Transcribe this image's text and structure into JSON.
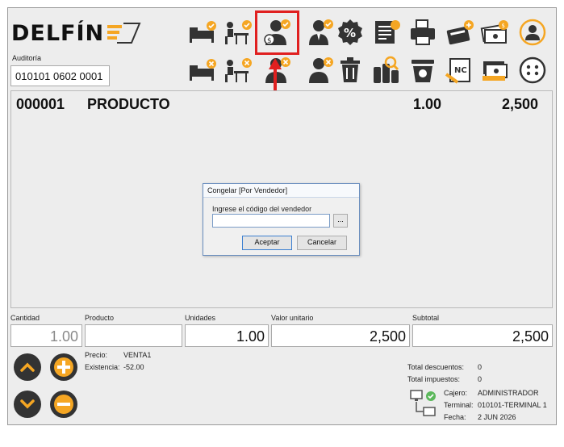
{
  "logo": {
    "text": "DELFÍN"
  },
  "audit": {
    "label": "Auditoría",
    "value": "010101 0602 0001"
  },
  "toolbar": {
    "top_icons": [
      "bed-check-icon",
      "desk-check-icon",
      "seller-money-check-icon",
      "person-check-icon",
      "percent-icon",
      "receipt-icon",
      "printer-icon",
      "cash-register-icon",
      "money-bills-icon",
      "user-refresh-icon"
    ],
    "bottom_icons": [
      "bed-x-icon",
      "desk-x-icon",
      "seller-x-icon",
      "person-x-icon",
      "trash-icon",
      "products-search-icon",
      "scale-icon",
      "credit-note-icon",
      "cash-icon",
      "more-options-icon"
    ]
  },
  "item": {
    "code": "000001",
    "name": "PRODUCTO",
    "qty": "1.00",
    "amount": "2,500"
  },
  "dialog": {
    "title": "Congelar [Por Vendedor]",
    "label": "Ingrese el código del vendedor",
    "input_value": "",
    "dots": "...",
    "accept": "Aceptar",
    "cancel": "Cancelar"
  },
  "fields": {
    "cantidad_label": "Cantidad",
    "cantidad_value": "1.00",
    "producto_label": "Producto",
    "producto_value": "",
    "unidades_label": "Unidades",
    "unidades_value": "1.00",
    "valor_label": "Valor unitario",
    "valor_value": "2,500",
    "subtotal_label": "Subtotal",
    "subtotal_value": "2,500"
  },
  "info": {
    "precio_label": "Precio:",
    "precio_value": "VENTA1",
    "existencia_label": "Existencia:",
    "existencia_value": "-52.00"
  },
  "totals": {
    "descuentos_label": "Total descuentos:",
    "descuentos_value": "0",
    "impuestos_label": "Total impuestos:",
    "impuestos_value": "0",
    "cajero_label": "Cajero:",
    "cajero_value": "ADMINISTRADOR",
    "terminal_label": "Terminal:",
    "terminal_value": "010101-TERMINAL 1",
    "fecha_label": "Fecha:",
    "fecha_value": "2 JUN 2026"
  },
  "colors": {
    "accent_orange": "#f5a623",
    "icon_dark": "#333333",
    "nav_red": "#e02020"
  }
}
